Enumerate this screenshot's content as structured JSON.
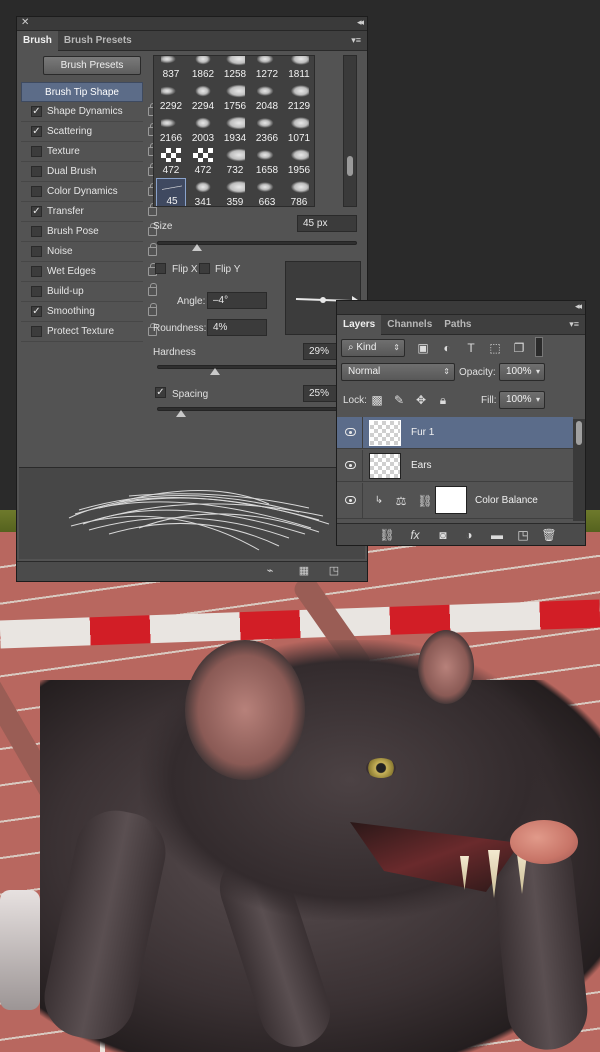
{
  "brush_panel": {
    "tabs": [
      "Brush",
      "Brush Presets"
    ],
    "presets_button": "Brush Presets",
    "options": [
      {
        "label": "Brush Tip Shape",
        "checked": null
      },
      {
        "label": "Shape Dynamics",
        "checked": true
      },
      {
        "label": "Scattering",
        "checked": true
      },
      {
        "label": "Texture",
        "checked": false
      },
      {
        "label": "Dual Brush",
        "checked": false
      },
      {
        "label": "Color Dynamics",
        "checked": false
      },
      {
        "label": "Transfer",
        "checked": true
      },
      {
        "label": "Brush Pose",
        "checked": false
      },
      {
        "label": "Noise",
        "checked": false
      },
      {
        "label": "Wet Edges",
        "checked": false
      },
      {
        "label": "Build-up",
        "checked": false
      },
      {
        "label": "Smoothing",
        "checked": true
      },
      {
        "label": "Protect Texture",
        "checked": false
      }
    ],
    "tip_sizes": [
      "837",
      "1862",
      "1258",
      "1272",
      "1811",
      "2292",
      "2294",
      "1756",
      "2048",
      "2129",
      "2166",
      "2003",
      "1934",
      "2366",
      "1071",
      "472",
      "472",
      "732",
      "1658",
      "1956",
      "45",
      "341",
      "359",
      "663",
      "786"
    ],
    "selected_tip": "45",
    "size_label": "Size",
    "size_value": "45 px",
    "size_slider_fraction": 0.2,
    "flip_x": "Flip X",
    "flip_y": "Flip Y",
    "angle_label": "Angle:",
    "angle_value": "–4°",
    "roundness_label": "Roundness:",
    "roundness_value": "4%",
    "hardness_label": "Hardness",
    "hardness_value": "29%",
    "hardness_slider_fraction": 0.29,
    "spacing_label": "Spacing",
    "spacing_checked": true,
    "spacing_value": "25%",
    "spacing_slider_fraction": 0.12
  },
  "layers_panel": {
    "tabs": [
      "Layers",
      "Channels",
      "Paths"
    ],
    "filter_kind": "Kind",
    "blend_mode": "Normal",
    "opacity_label": "Opacity:",
    "opacity_value": "100%",
    "lock_label": "Lock:",
    "fill_label": "Fill:",
    "fill_value": "100%",
    "layers": [
      {
        "name": "Fur 1",
        "selected": true
      },
      {
        "name": "Ears",
        "selected": false
      },
      {
        "name": "Color Balance",
        "selected": false
      }
    ]
  },
  "colors": {
    "panel_bg": "#535353",
    "selection": "#5b6c8a",
    "barrier_red": "#d21e26"
  }
}
